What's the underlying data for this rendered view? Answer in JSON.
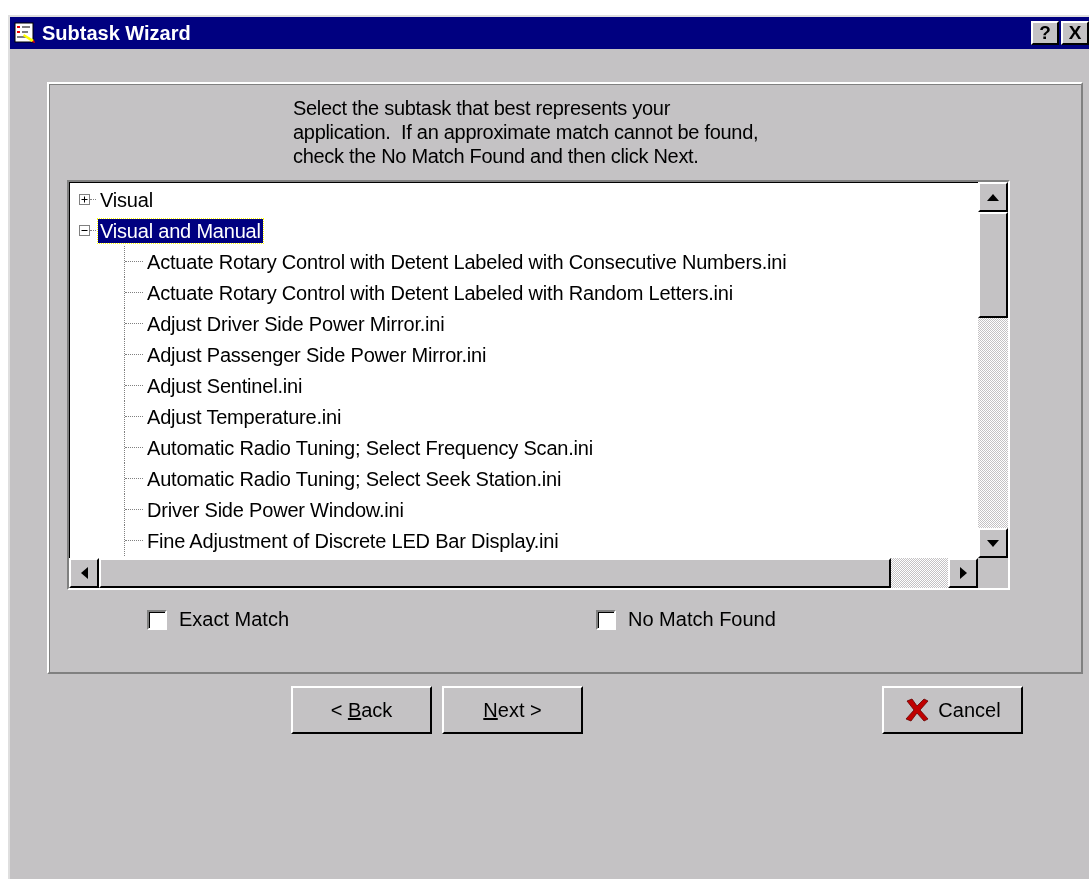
{
  "window": {
    "title": "Subtask Wizard"
  },
  "title_buttons": [
    {
      "label": "?"
    },
    {
      "label": "X"
    }
  ],
  "instructions": [
    "Select the subtask that best represents your",
    "application.  If an approximate match cannot be found,",
    "check the No Match Found and then click Next."
  ],
  "tree": [
    {
      "label": "Visual",
      "expanded": false,
      "selected": false
    },
    {
      "label": "Visual and Manual",
      "expanded": true,
      "selected": true,
      "children": [
        {
          "label": "Actuate Rotary Control with Detent Labeled with Consecutive Numbers.ini",
          "selected": false
        },
        {
          "label": "Actuate Rotary Control with Detent Labeled with Random Letters.ini",
          "selected": false
        },
        {
          "label": "Adjust Driver Side Power Mirror.ini",
          "selected": false
        },
        {
          "label": "Adjust Passenger Side Power Mirror.ini",
          "selected": false
        },
        {
          "label": "Adjust Sentinel.ini",
          "selected": false
        },
        {
          "label": "Adjust Temperature.ini",
          "selected": false
        },
        {
          "label": "Automatic Radio Tuning; Select Frequency Scan.ini",
          "selected": false
        },
        {
          "label": "Automatic Radio Tuning; Select Seek Station.ini",
          "selected": false
        },
        {
          "label": "Driver Side Power Window.ini",
          "selected": false
        },
        {
          "label": "Fine Adjustment of Discrete LED Bar Display.ini",
          "selected": false
        }
      ]
    }
  ],
  "checkboxes": [
    {
      "label": "Exact Match",
      "checked": false
    },
    {
      "label": "No Match Found",
      "checked": false
    }
  ],
  "buttons": [
    {
      "kind": "back",
      "label_before": "< ",
      "mnemonic": "B",
      "label_after": "ack"
    },
    {
      "kind": "next",
      "mnemonic": "N",
      "label_after": "ext >"
    },
    {
      "kind": "cancel",
      "label_after": "Cancel"
    }
  ]
}
